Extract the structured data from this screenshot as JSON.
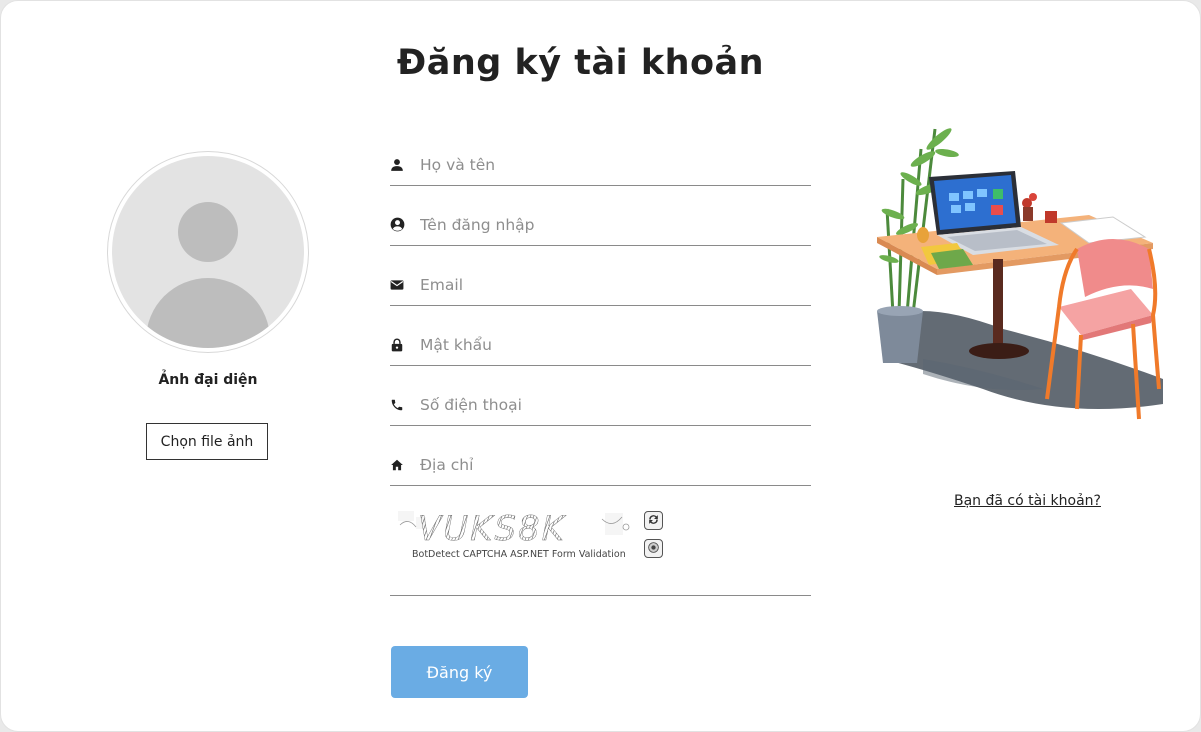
{
  "page": {
    "title": "Đăng ký tài khoản"
  },
  "avatar": {
    "label": "Ảnh đại diện",
    "choose_file_label": "Chọn file ảnh"
  },
  "form": {
    "fields": [
      {
        "name": "fullname",
        "icon": "person-icon",
        "placeholder": "Họ và tên",
        "value": ""
      },
      {
        "name": "username",
        "icon": "account-circle-icon",
        "placeholder": "Tên đăng nhập",
        "value": ""
      },
      {
        "name": "email",
        "icon": "mail-icon",
        "placeholder": "Email",
        "value": ""
      },
      {
        "name": "password",
        "icon": "lock-icon",
        "placeholder": "Mật khẩu",
        "value": ""
      },
      {
        "name": "phone",
        "icon": "phone-icon",
        "placeholder": "Số điện thoại",
        "value": ""
      },
      {
        "name": "address",
        "icon": "home-icon",
        "placeholder": "Địa chỉ",
        "value": ""
      }
    ],
    "captcha": {
      "code": "VUKS8K",
      "caption": "BotDetect CAPTCHA ASP.NET Form Validation",
      "reload_icon": "reload-icon",
      "sound_icon": "speaker-icon",
      "input_value": ""
    },
    "submit_label": "Đăng ký"
  },
  "sidebar": {
    "login_link": "Bạn đã có tài khoản?"
  },
  "colors": {
    "submit_bg": "#6aace4",
    "field_line": "#8a8a8a",
    "avatar_bg": "#e3e3e3",
    "avatar_fg": "#bdbdbd"
  }
}
